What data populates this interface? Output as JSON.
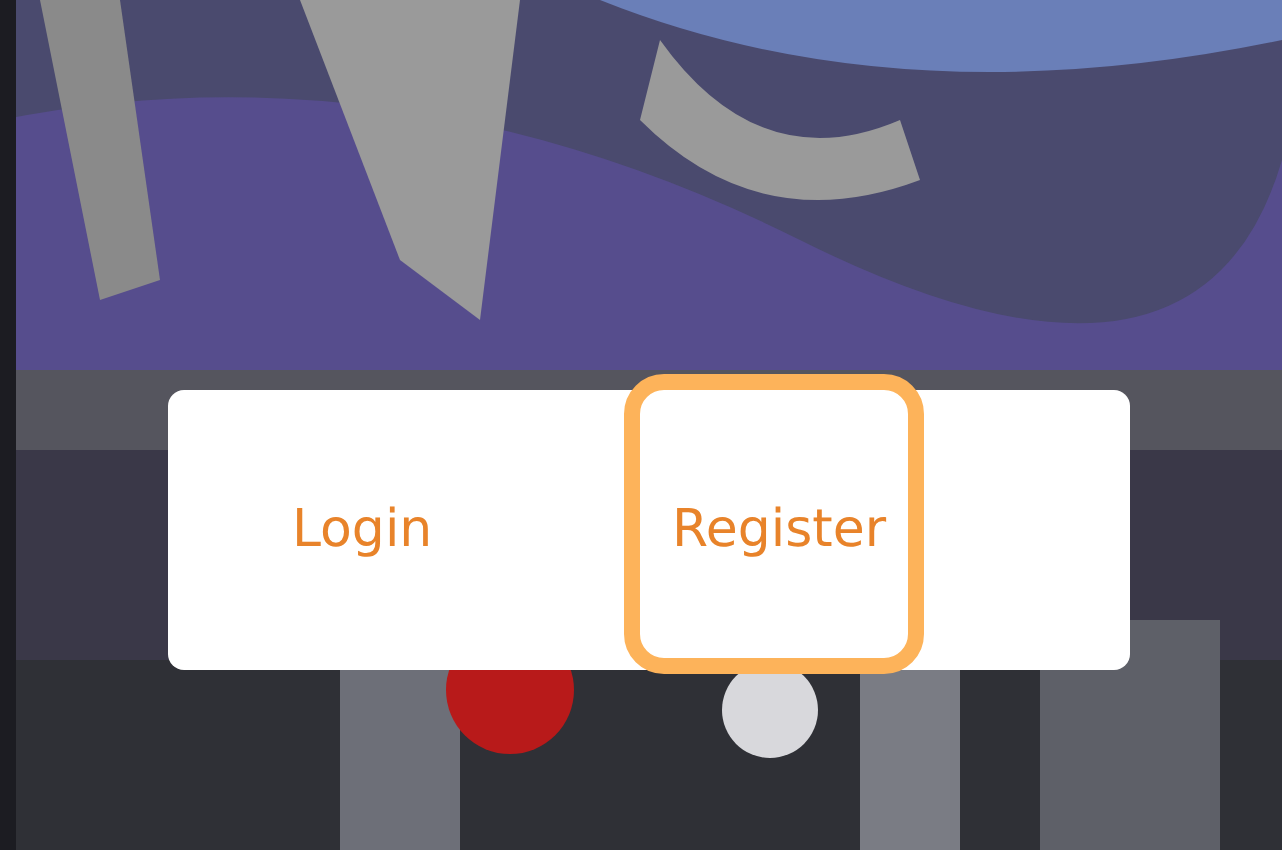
{
  "dialog": {
    "buttons": [
      {
        "label": "Login",
        "highlighted": false
      },
      {
        "label": "Register",
        "highlighted": true
      }
    ]
  }
}
